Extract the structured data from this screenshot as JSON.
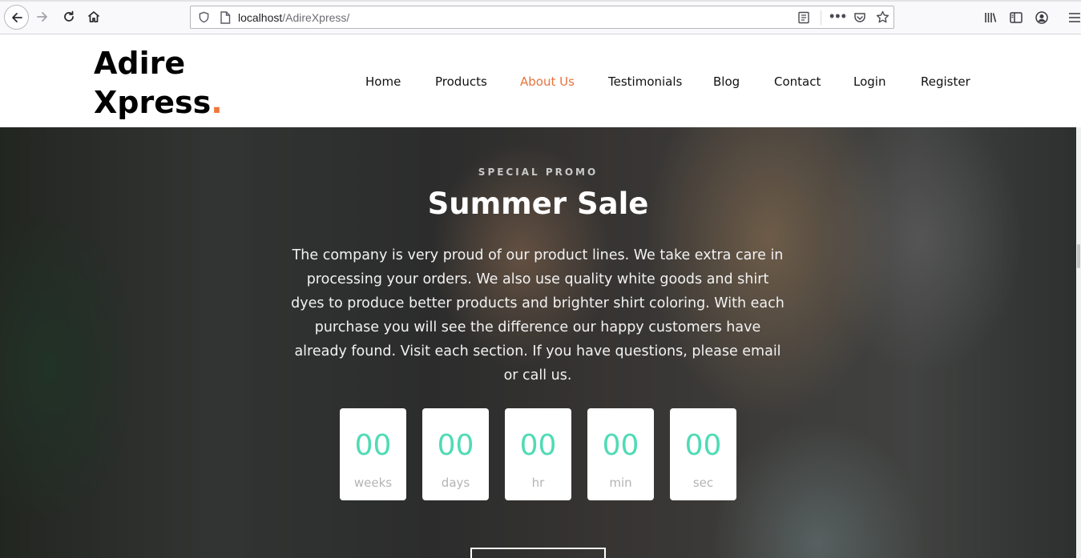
{
  "browser": {
    "url_host": "localhost",
    "url_path": "/AdireXpress/"
  },
  "site": {
    "logo_line1": "Adire",
    "logo_line2": "Xpress",
    "logo_dot": ".",
    "accent_color": "#e8733b",
    "nav": [
      {
        "label": "Home"
      },
      {
        "label": "Products"
      },
      {
        "label": "About Us",
        "active": true
      },
      {
        "label": "Testimonials"
      },
      {
        "label": "Blog"
      },
      {
        "label": "Contact"
      },
      {
        "label": "Login"
      },
      {
        "label": "Register"
      }
    ]
  },
  "hero": {
    "eyebrow": "SPECIAL PROMO",
    "title": "Summer Sale",
    "text": "The company is very proud of our product lines. We take extra care in processing your orders. We also use quality white goods and shirt dyes to produce better products and brighter shirt coloring. With each purchase you will see the difference our happy customers have already found. Visit each section. If you have questions, please email or call us.",
    "countdown": [
      {
        "value": "00",
        "label": "weeks"
      },
      {
        "value": "00",
        "label": "days"
      },
      {
        "value": "00",
        "label": "hr"
      },
      {
        "value": "00",
        "label": "min"
      },
      {
        "value": "00",
        "label": "sec"
      }
    ],
    "countdown_color": "#4fdbb5"
  }
}
